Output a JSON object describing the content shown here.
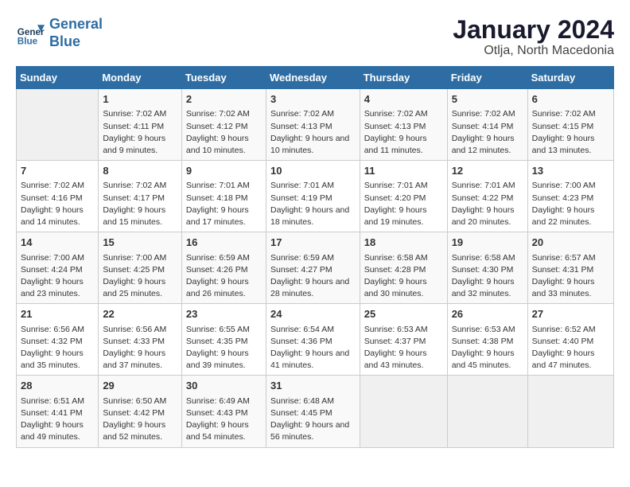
{
  "header": {
    "logo_line1": "General",
    "logo_line2": "Blue",
    "month": "January 2024",
    "location": "Otlja, North Macedonia"
  },
  "days_of_week": [
    "Sunday",
    "Monday",
    "Tuesday",
    "Wednesday",
    "Thursday",
    "Friday",
    "Saturday"
  ],
  "weeks": [
    [
      {
        "day": "",
        "empty": true
      },
      {
        "day": "1",
        "sunrise": "7:02 AM",
        "sunset": "4:11 PM",
        "daylight": "9 hours and 9 minutes."
      },
      {
        "day": "2",
        "sunrise": "7:02 AM",
        "sunset": "4:12 PM",
        "daylight": "9 hours and 10 minutes."
      },
      {
        "day": "3",
        "sunrise": "7:02 AM",
        "sunset": "4:13 PM",
        "daylight": "9 hours and 10 minutes."
      },
      {
        "day": "4",
        "sunrise": "7:02 AM",
        "sunset": "4:13 PM",
        "daylight": "9 hours and 11 minutes."
      },
      {
        "day": "5",
        "sunrise": "7:02 AM",
        "sunset": "4:14 PM",
        "daylight": "9 hours and 12 minutes."
      },
      {
        "day": "6",
        "sunrise": "7:02 AM",
        "sunset": "4:15 PM",
        "daylight": "9 hours and 13 minutes."
      }
    ],
    [
      {
        "day": "7",
        "sunrise": "7:02 AM",
        "sunset": "4:16 PM",
        "daylight": "9 hours and 14 minutes."
      },
      {
        "day": "8",
        "sunrise": "7:02 AM",
        "sunset": "4:17 PM",
        "daylight": "9 hours and 15 minutes."
      },
      {
        "day": "9",
        "sunrise": "7:01 AM",
        "sunset": "4:18 PM",
        "daylight": "9 hours and 17 minutes."
      },
      {
        "day": "10",
        "sunrise": "7:01 AM",
        "sunset": "4:19 PM",
        "daylight": "9 hours and 18 minutes."
      },
      {
        "day": "11",
        "sunrise": "7:01 AM",
        "sunset": "4:20 PM",
        "daylight": "9 hours and 19 minutes."
      },
      {
        "day": "12",
        "sunrise": "7:01 AM",
        "sunset": "4:22 PM",
        "daylight": "9 hours and 20 minutes."
      },
      {
        "day": "13",
        "sunrise": "7:00 AM",
        "sunset": "4:23 PM",
        "daylight": "9 hours and 22 minutes."
      }
    ],
    [
      {
        "day": "14",
        "sunrise": "7:00 AM",
        "sunset": "4:24 PM",
        "daylight": "9 hours and 23 minutes."
      },
      {
        "day": "15",
        "sunrise": "7:00 AM",
        "sunset": "4:25 PM",
        "daylight": "9 hours and 25 minutes."
      },
      {
        "day": "16",
        "sunrise": "6:59 AM",
        "sunset": "4:26 PM",
        "daylight": "9 hours and 26 minutes."
      },
      {
        "day": "17",
        "sunrise": "6:59 AM",
        "sunset": "4:27 PM",
        "daylight": "9 hours and 28 minutes."
      },
      {
        "day": "18",
        "sunrise": "6:58 AM",
        "sunset": "4:28 PM",
        "daylight": "9 hours and 30 minutes."
      },
      {
        "day": "19",
        "sunrise": "6:58 AM",
        "sunset": "4:30 PM",
        "daylight": "9 hours and 32 minutes."
      },
      {
        "day": "20",
        "sunrise": "6:57 AM",
        "sunset": "4:31 PM",
        "daylight": "9 hours and 33 minutes."
      }
    ],
    [
      {
        "day": "21",
        "sunrise": "6:56 AM",
        "sunset": "4:32 PM",
        "daylight": "9 hours and 35 minutes."
      },
      {
        "day": "22",
        "sunrise": "6:56 AM",
        "sunset": "4:33 PM",
        "daylight": "9 hours and 37 minutes."
      },
      {
        "day": "23",
        "sunrise": "6:55 AM",
        "sunset": "4:35 PM",
        "daylight": "9 hours and 39 minutes."
      },
      {
        "day": "24",
        "sunrise": "6:54 AM",
        "sunset": "4:36 PM",
        "daylight": "9 hours and 41 minutes."
      },
      {
        "day": "25",
        "sunrise": "6:53 AM",
        "sunset": "4:37 PM",
        "daylight": "9 hours and 43 minutes."
      },
      {
        "day": "26",
        "sunrise": "6:53 AM",
        "sunset": "4:38 PM",
        "daylight": "9 hours and 45 minutes."
      },
      {
        "day": "27",
        "sunrise": "6:52 AM",
        "sunset": "4:40 PM",
        "daylight": "9 hours and 47 minutes."
      }
    ],
    [
      {
        "day": "28",
        "sunrise": "6:51 AM",
        "sunset": "4:41 PM",
        "daylight": "9 hours and 49 minutes."
      },
      {
        "day": "29",
        "sunrise": "6:50 AM",
        "sunset": "4:42 PM",
        "daylight": "9 hours and 52 minutes."
      },
      {
        "day": "30",
        "sunrise": "6:49 AM",
        "sunset": "4:43 PM",
        "daylight": "9 hours and 54 minutes."
      },
      {
        "day": "31",
        "sunrise": "6:48 AM",
        "sunset": "4:45 PM",
        "daylight": "9 hours and 56 minutes."
      },
      {
        "day": "",
        "empty": true
      },
      {
        "day": "",
        "empty": true
      },
      {
        "day": "",
        "empty": true
      }
    ]
  ],
  "labels": {
    "sunrise_prefix": "Sunrise: ",
    "sunset_prefix": "Sunset: ",
    "daylight_prefix": "Daylight: "
  }
}
